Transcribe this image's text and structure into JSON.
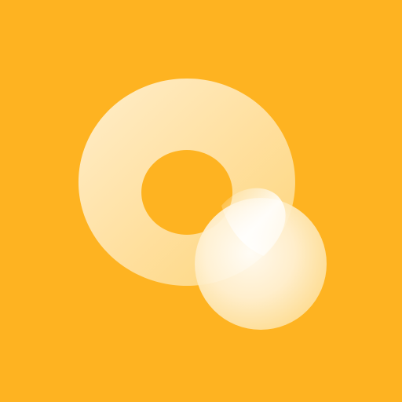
{
  "icon": {
    "name": "app-logo-icon",
    "colors": {
      "background": "#FEB321",
      "ring_light": "#FFF3DA",
      "ring_mid": "#FFE3A8",
      "ring_soft": "#FDD882",
      "highlight": "#FFFFFF"
    }
  }
}
